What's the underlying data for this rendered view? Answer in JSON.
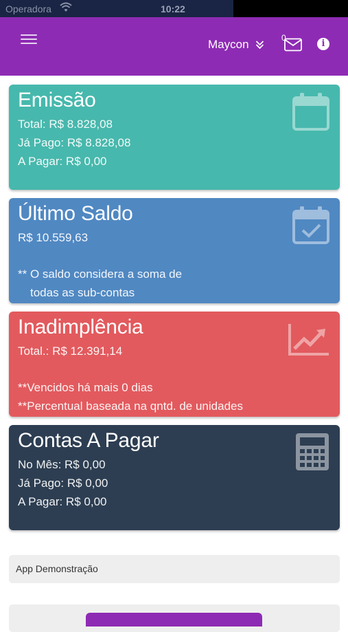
{
  "status_bar": {
    "carrier": "Operadora",
    "time": "10:22"
  },
  "header": {
    "user_name": "Maycon",
    "message_count": "0",
    "menu_icon": "hamburger-icon",
    "chevron_icon": "double-chevron-down-icon",
    "mail_icon": "envelope-icon",
    "info_icon": "info-icon",
    "info_glyph": "i",
    "color": "#8e2bb4"
  },
  "cards": {
    "emissao": {
      "title": "Emissão",
      "line1": "Total: R$ 8.828,08",
      "line2": "Já Pago: R$ 8.828,08",
      "line3": "A Pagar: R$ 0,00",
      "icon": "calendar-icon",
      "color": "#47b8ad"
    },
    "saldo": {
      "title": "Último Saldo",
      "line1": "R$ 10.559,63",
      "note1": "** O saldo considera a soma de",
      "note2": "todas as sub-contas",
      "icon": "calendar-check-icon",
      "color": "#5088c2"
    },
    "inadimplencia": {
      "title": "Inadimplência",
      "line1": "Total.: R$ 12.391,14",
      "note1": "**Vencidos há mais 0 dias",
      "note2": "**Percentual baseada na qntd. de unidades",
      "icon": "line-chart-icon",
      "color": "#e25a5e"
    },
    "contas": {
      "title": "Contas A Pagar",
      "line1": "No Mês: R$ 0,00",
      "line2": "Já Pago: R$ 0,00",
      "line3": "A Pagar: R$ 0,00",
      "icon": "calculator-icon",
      "color": "#2d3e52"
    }
  },
  "app_panel": {
    "label": "App Demonstração"
  }
}
